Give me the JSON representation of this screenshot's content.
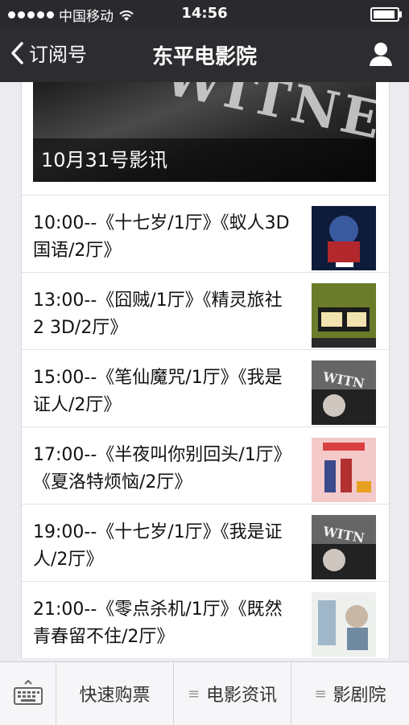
{
  "status": {
    "carrier": "中国移动",
    "time": "14:56",
    "battery_level": 0.92
  },
  "nav": {
    "back_label": "订阅号",
    "title": "东平电影院"
  },
  "banner": {
    "caption": "10月31号影讯",
    "image_text": "WITNESS"
  },
  "schedule": [
    {
      "text": "10:00--《十七岁/1厅》《蚁人3D国语/2厅》",
      "thumb": "ant-man-poster-icon"
    },
    {
      "text": "13:00--《囧贼/1厅》《精灵旅社2 3D/2厅》",
      "thumb": "comedy-poster-icon"
    },
    {
      "text": "15:00--《笔仙魔咒/1厅》《我是证人/2厅》",
      "thumb": "witness-poster-icon"
    },
    {
      "text": "17:00--《半夜叫你别回头/1厅》《夏洛特烦恼/2厅》",
      "thumb": "charlotte-poster-icon"
    },
    {
      "text": "19:00--《十七岁/1厅》《我是证人/2厅》",
      "thumb": "witness-poster-icon"
    },
    {
      "text": "21:00--《零点杀机/1厅》《既然青春留不住/2厅》",
      "thumb": "youth-poster-icon"
    }
  ],
  "tabbar": {
    "keyboard_icon": "keyboard-icon",
    "tab1": "快速购票",
    "tab2": "电影资讯",
    "tab3": "影剧院",
    "menu_glyph": "≡"
  },
  "colors": {
    "nav_bg": "#2d2d31",
    "status_bg": "#2a2a2e",
    "page_bg": "#ecebf0"
  }
}
